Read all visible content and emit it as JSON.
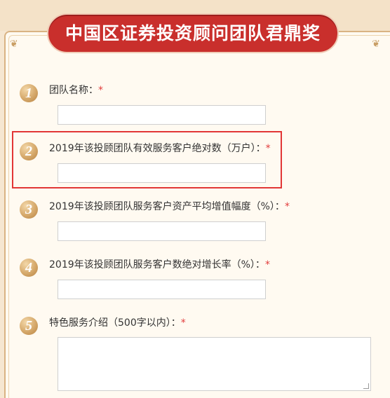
{
  "title": "中国区证券投资顾问团队君鼎奖",
  "form": {
    "fields": [
      {
        "number": "1",
        "label": "团队名称：",
        "required_mark": "*",
        "value": ""
      },
      {
        "number": "2",
        "label": "2019年该投顾团队有效服务客户绝对数（万户）：",
        "required_mark": "*",
        "value": ""
      },
      {
        "number": "3",
        "label": "2019年该投顾团队服务客户资产平均增值幅度（%）：",
        "required_mark": "*",
        "value": ""
      },
      {
        "number": "4",
        "label": "2019年该投顾团队服务客户数绝对增长率（%）：",
        "required_mark": "*",
        "value": ""
      },
      {
        "number": "5",
        "label": "特色服务介绍（500字以内）：",
        "required_mark": "*",
        "value": ""
      }
    ]
  },
  "colors": {
    "banner": "#c92f2c",
    "highlight": "#e23636",
    "required": "#e23c3c"
  }
}
